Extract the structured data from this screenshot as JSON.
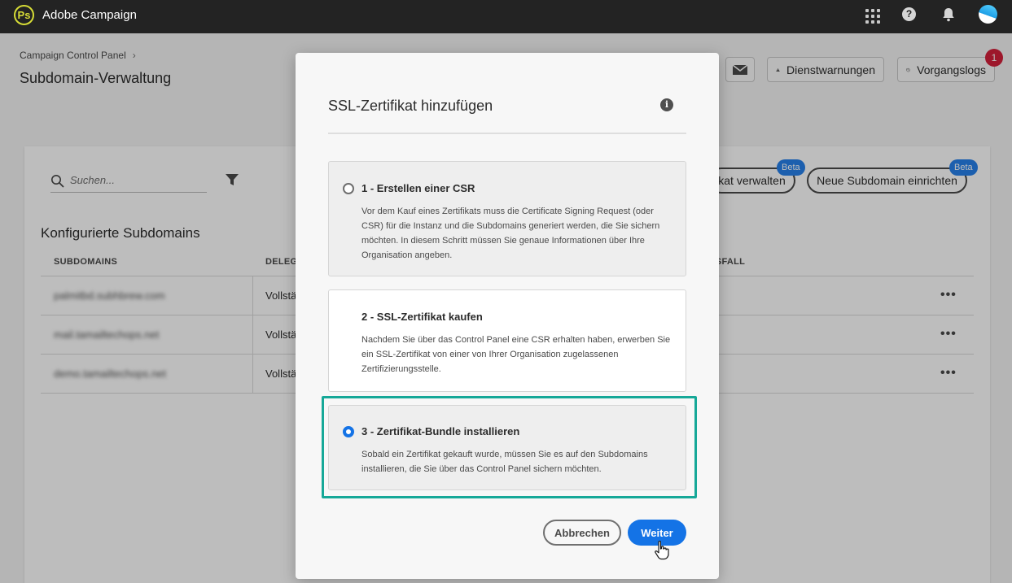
{
  "topbar": {
    "app_title": "Adobe Campaign",
    "logo_glyph": "Ps",
    "help_glyph": "?",
    "icons": [
      "adobe-campaign-logo-icon",
      "apps-grid-icon",
      "help-icon",
      "bell-icon",
      "avatar"
    ]
  },
  "header": {
    "breadcrumb": "Campaign Control Panel",
    "breadcrumb_sep": "›",
    "page_title": "Subdomain-Verwaltung",
    "service_warnings_label": "Dienstwarnungen",
    "activity_logs_label": "Vorgangslogs",
    "activity_logs_count": "1"
  },
  "toolbar": {
    "search_placeholder": "Suchen...",
    "manage_cert_label": "kat verwalten",
    "new_subdomain_label": "Neue Subdomain einrichten",
    "beta_label": "Beta"
  },
  "table": {
    "section_title": "Konfigurierte Subdomains",
    "columns": [
      "SUBDOMAINS",
      "DELEGA",
      "GSFALL"
    ],
    "rows": [
      {
        "subdomain": "palmitbd.subhbrew.com",
        "delegation": "Vollstä"
      },
      {
        "subdomain": "mail.tamailtechops.net",
        "delegation": "Vollstä"
      },
      {
        "subdomain": "demo.tamailtechops.net",
        "delegation": "Vollstä"
      }
    ],
    "more_glyph": "•••"
  },
  "modal": {
    "title": "SSL-Zertifikat hinzufügen",
    "info_glyph": "i",
    "options": [
      {
        "title": "1 - Erstellen einer CSR",
        "description": "Vor dem Kauf eines Zertifikats muss die Certificate Signing Request (oder CSR) für die Instanz und die Subdomains generiert werden, die Sie sichern möchten. In diesem Schritt müssen Sie genaue Informationen über Ihre Organisation angeben."
      },
      {
        "title": "2 - SSL-Zertifikat kaufen",
        "description": "Nachdem Sie über das Control Panel eine CSR erhalten haben, erwerben Sie ein SSL-Zertifikat von einer von Ihrer Organisation zugelassenen Zertifizierungsstelle."
      },
      {
        "title": "3 - Zertifikat-Bundle installieren",
        "description": "Sobald ein Zertifikat gekauft wurde, müssen Sie es auf den Subdomains installieren, die Sie über das Control Panel sichern möchten."
      }
    ],
    "selected_option": 3,
    "cancel_label": "Abbrechen",
    "next_label": "Weiter"
  },
  "colors": {
    "topbar": "#232323",
    "accent": "#1473e6",
    "highlight": "#16a898",
    "badge": "#d4203a",
    "logo": "#d6dc36"
  }
}
